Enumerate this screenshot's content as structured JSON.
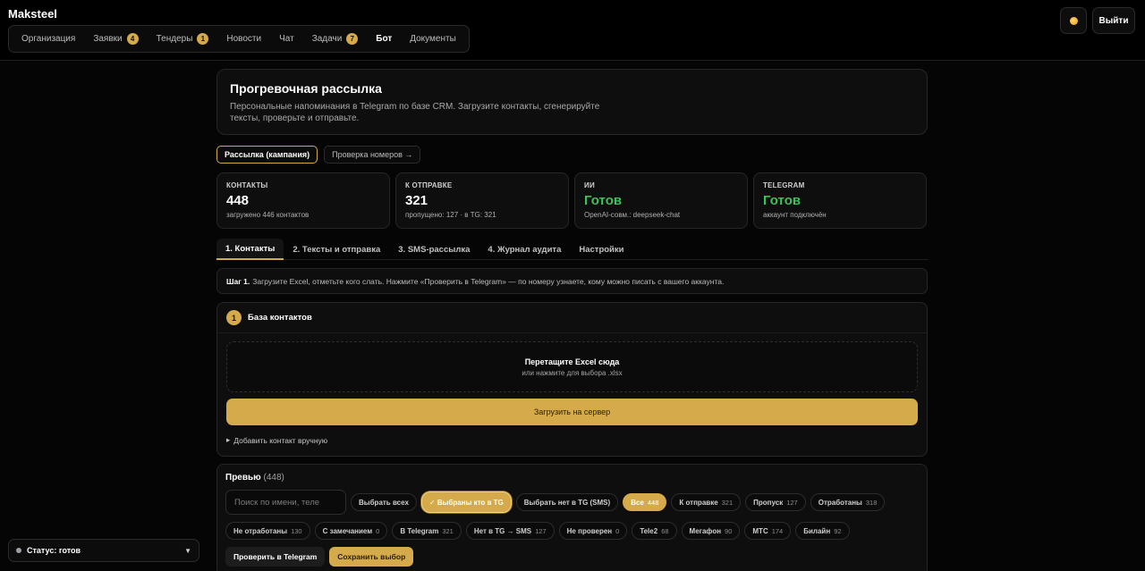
{
  "brand": "Maksteel",
  "nav": [
    {
      "label": "Организация",
      "badge": null
    },
    {
      "label": "Заявки",
      "badge": "4"
    },
    {
      "label": "Тендеры",
      "badge": "1"
    },
    {
      "label": "Новости",
      "badge": null
    },
    {
      "label": "Чат",
      "badge": null
    },
    {
      "label": "Задачи",
      "badge": "7"
    },
    {
      "label": "Бот",
      "badge": null,
      "active": true
    },
    {
      "label": "Документы",
      "badge": null
    }
  ],
  "header": {
    "logout_label": "Выйти",
    "theme_icon": "sun-icon"
  },
  "hero": {
    "title": "Прогревочная рассылка",
    "description": "Персональные напоминания в Telegram по базе CRM. Загрузите контакты, сгенерируйте тексты, проверьте и отправьте."
  },
  "mode_tabs": [
    "Рассылка (кампания)",
    "Проверка номеров →"
  ],
  "stats": [
    {
      "label": "КОНТАКТЫ",
      "value": "448",
      "sub": "загружено 446 контактов"
    },
    {
      "label": "К ОТПРАВКЕ",
      "value": "321",
      "sub": "пропущено: 127 · в TG: 321"
    },
    {
      "label": "ИИ",
      "value": "Готов",
      "sub": "OpenAI-совм.: deepseek-chat"
    },
    {
      "label": "TELEGRAM",
      "value": "Готов",
      "sub": "аккаунт подключён"
    }
  ],
  "steps": [
    "1. Контакты",
    "2. Тексты и отправка",
    "3. SMS-рассылка",
    "4. Журнал аудита",
    "Настройки"
  ],
  "hint": {
    "bold": "Шаг 1.",
    "text": "Загрузите Excel, отметьте кого слать. Нажмите «Проверить в Telegram» — по номеру узнаете, кому можно писать с вашего аккаунта."
  },
  "contacts_panel": {
    "number": "1",
    "title": "База контактов",
    "drop_title": "Перетащите Excel сюда",
    "drop_sub": "или нажмите для выбора .xlsx",
    "upload_label": "Загрузить на сервер",
    "manual_label": "Добавить контакт вручную"
  },
  "preview": {
    "title": "Превью",
    "count": "(448)",
    "search_placeholder": "Поиск по имени, теле",
    "buttons": {
      "select_all": "Выбрать всех",
      "select_tg": "✓ Выбраны кто в TG",
      "select_no_tg": "Выбрать нет в TG (SMS)"
    },
    "filters_row1": [
      {
        "label": "Все",
        "count": "448",
        "gold": true
      },
      {
        "label": "К отправке",
        "count": "321"
      },
      {
        "label": "Пропуск",
        "count": "127"
      },
      {
        "label": "Отработаны",
        "count": "318"
      }
    ],
    "filters_row2": [
      {
        "label": "Не отработаны",
        "count": "130"
      },
      {
        "label": "С замечанием",
        "count": "0"
      },
      {
        "label": "В Telegram",
        "count": "321"
      },
      {
        "label": "Нет в TG → SMS",
        "count": "127"
      },
      {
        "label": "Не проверен",
        "count": "0"
      },
      {
        "label": "Tele2",
        "count": "68"
      },
      {
        "label": "Мегафон",
        "count": "90"
      },
      {
        "label": "МТС",
        "count": "174"
      },
      {
        "label": "Билайн",
        "count": "92"
      }
    ],
    "actions": [
      "Проверить в Telegram",
      "Сохранить выбор"
    ]
  },
  "status": {
    "label": "Статус: готов"
  }
}
